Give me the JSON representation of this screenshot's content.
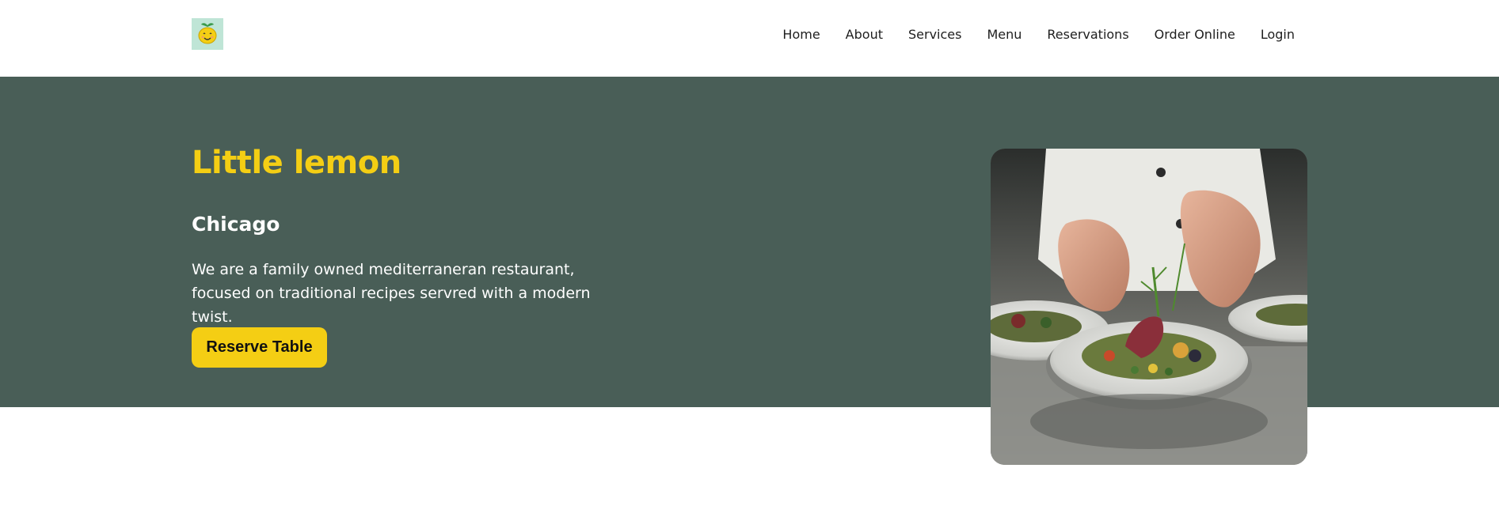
{
  "brand": {
    "logo_icon": "lemon-logo-icon",
    "logo_bg": "#bfe5d6"
  },
  "nav": {
    "items": [
      {
        "label": "Home"
      },
      {
        "label": "About"
      },
      {
        "label": "Services"
      },
      {
        "label": "Menu"
      },
      {
        "label": "Reservations"
      },
      {
        "label": "Order Online"
      },
      {
        "label": "Login"
      }
    ]
  },
  "hero": {
    "title": "Little lemon",
    "subtitle": "Chicago",
    "description": "We are a family owned mediterraneran restaurant, focused on traditional recipes servred with a modern twist.",
    "cta_label": "Reserve Table",
    "image_subject": "chef-plating-food-photo"
  },
  "colors": {
    "primary_green": "#495e57",
    "primary_yellow": "#f4ce14",
    "text_dark": "#1e1e1e",
    "white": "#ffffff"
  }
}
